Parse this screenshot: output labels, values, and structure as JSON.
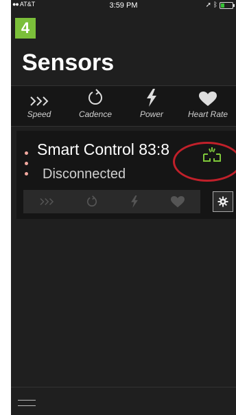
{
  "status_bar": {
    "carrier": "AT&T",
    "time": "3:59 PM"
  },
  "step_badge": "4",
  "title": "Sensors",
  "sensor_types": [
    {
      "label": "Speed",
      "icon": "chevrons-icon"
    },
    {
      "label": "Cadence",
      "icon": "refresh-icon"
    },
    {
      "label": "Power",
      "icon": "lightning-icon"
    },
    {
      "label": "Heart Rate",
      "icon": "heart-icon"
    }
  ],
  "device": {
    "name": "Smart Control 83:8",
    "status": "Disconnected",
    "connection_icon_color": "#7ec83a",
    "highlight_color": "#c0202a"
  },
  "colors": {
    "background": "#1f1f1f",
    "badge": "#7bbf3a",
    "dots": "#f2a9a0"
  }
}
